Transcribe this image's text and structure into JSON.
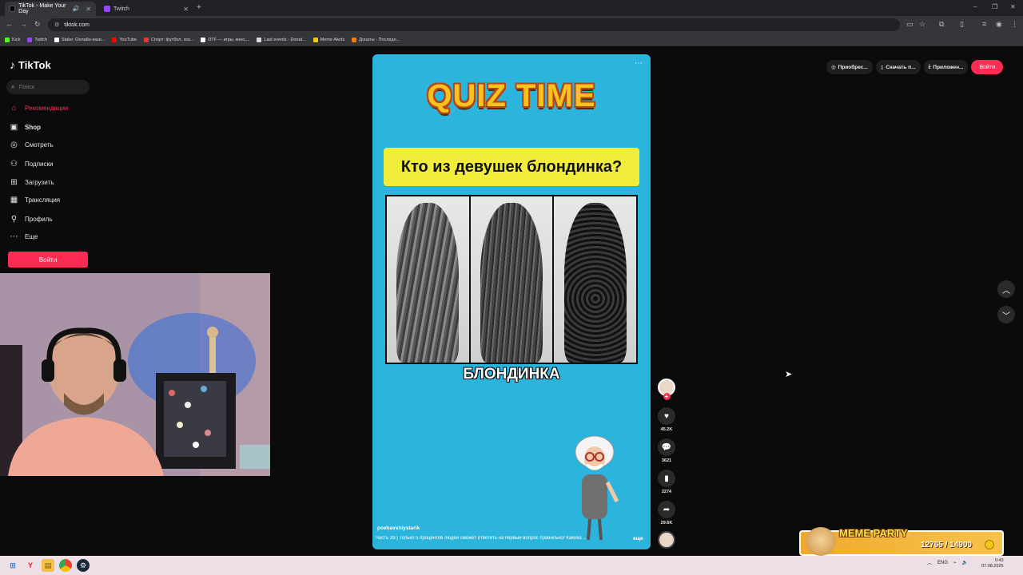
{
  "browser": {
    "tabs": [
      {
        "title": "TikTok - Make Your Day",
        "active": true
      },
      {
        "title": "Twitch",
        "active": false
      }
    ],
    "url": "tiktok.com",
    "bookmarks": [
      {
        "label": "Kick",
        "color": "#53fc18"
      },
      {
        "label": "Twitch",
        "color": "#9146ff"
      },
      {
        "label": "Stake: Онлайн-кази...",
        "color": "#ffffff"
      },
      {
        "label": "YouTube",
        "color": "#ff0000"
      },
      {
        "label": "Спорт: футбол, хок...",
        "color": "#e53935"
      },
      {
        "label": "DTF — игры, кино,...",
        "color": "#ffffff"
      },
      {
        "label": "Last events - Donat...",
        "color": "#ffffff"
      },
      {
        "label": "Meme Alerts",
        "color": "#f5c518"
      },
      {
        "label": "Донаты - Последн...",
        "color": "#f57c00"
      }
    ]
  },
  "sidebar": {
    "logo": "TikTok",
    "search_placeholder": "Поиск",
    "items": [
      {
        "label": "Рекомендации",
        "icon": "home-icon",
        "active": true
      },
      {
        "label": "Shop",
        "icon": "bag-icon",
        "active": false
      },
      {
        "label": "Смотреть",
        "icon": "compass-icon",
        "active": false
      },
      {
        "label": "Подписки",
        "icon": "user-follow-icon",
        "active": false
      },
      {
        "label": "Загрузить",
        "icon": "upload-icon",
        "active": false
      },
      {
        "label": "Трансляция",
        "icon": "live-tv-icon",
        "active": false
      },
      {
        "label": "Профиль",
        "icon": "profile-icon",
        "active": false
      },
      {
        "label": "Еще",
        "icon": "more-dots-icon",
        "active": false
      }
    ],
    "login_label": "Войти"
  },
  "video": {
    "headline": "QUIZ TIME",
    "question": "Кто из девушек блондинка?",
    "answer": "БЛОНДИНКА",
    "author": "poehavshiystarik",
    "caption": "Часть 39 | Только 5 процентов людей сможет ответить на первый вопрос правильно! Какова ...",
    "more_label": "еще"
  },
  "actions": {
    "likes": "45.2K",
    "comments": "3621",
    "saves": "2274",
    "shares": "29.6K"
  },
  "topright": {
    "buttons": [
      "Приобрес...",
      "Скачать п...",
      "Приложен..."
    ],
    "login_label": "Войти"
  },
  "overlay": {
    "title": "MEME PARTY",
    "counter": "12765 / 14900"
  },
  "taskbar": {
    "lang": "ENG",
    "time": "0:43",
    "date": "07.08.2025"
  }
}
